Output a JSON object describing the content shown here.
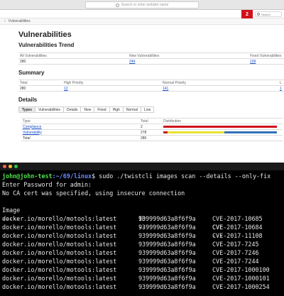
{
  "browser": {
    "url_placeholder": "Search or enter website name"
  },
  "app": {
    "alert_count": "2",
    "search_placeholder": "Search",
    "breadcrumb": "Vulnerabilities"
  },
  "report": {
    "title": "Vulnerabilities",
    "trend_title": "Vulnerabilities Trend",
    "trend_headers": [
      "All Vulnerabilities",
      "New Vulnerabilities",
      "Fixed Vulnerabilities"
    ],
    "trend_values": [
      "280",
      "244",
      "109"
    ],
    "summary_title": "Summary",
    "summary_headers": [
      "Total",
      "High Priority",
      "Normal Priority",
      "L"
    ],
    "summary_values": [
      "280",
      "12",
      "141",
      "1"
    ],
    "details_title": "Details",
    "tabs": [
      "Types",
      "Vulnerabilities",
      "Details",
      "New",
      "Fixed",
      "High",
      "Normal",
      "Low"
    ],
    "types_headers": [
      "Type",
      "Total",
      "Distribution"
    ],
    "types_rows": [
      {
        "type": "Compliance",
        "total": "2",
        "dist": {
          "high": 1.0,
          "normal": 0.0,
          "low": 0.0
        }
      },
      {
        "type": "Vulnerability",
        "total": "278",
        "dist": {
          "high": 0.04,
          "normal": 0.5,
          "low": 0.46
        }
      }
    ],
    "types_total_label": "Total",
    "types_total_value": "280"
  },
  "colors": {
    "high": "#d0111a",
    "normal": "#e8e231",
    "low": "#2f71b8"
  },
  "terminal": {
    "prompt_user": "john@john-test",
    "prompt_path": ":~/69/linux",
    "command": "$ sudo ./twistcli images scan --details --only-fix",
    "line_password": "Enter Password for admin:",
    "line_ca": "No CA cert was specified, using insecure connection",
    "headers": [
      "Image",
      "ID",
      "CVE"
    ],
    "dashes": [
      "-----",
      "--",
      "---"
    ],
    "rows": [
      [
        "docker.io/morello/motools:latest",
        "939999d63a8f6f9a",
        "CVE-2017-10685"
      ],
      [
        "docker.io/morello/motools:latest",
        "939999d63a8f6f9a",
        "CVE-2017-10684"
      ],
      [
        "docker.io/morello/motools:latest",
        "939999d63a8f6f9a",
        "CVE-2017-11108"
      ],
      [
        "docker.io/morello/motools:latest",
        "939999d63a8f6f9a",
        "CVE-2017-7245"
      ],
      [
        "docker.io/morello/motools:latest",
        "939999d63a8f6f9a",
        "CVE-2017-7246"
      ],
      [
        "docker.io/morello/motools:latest",
        "939999d63a8f6f9a",
        "CVE-2017-7244"
      ],
      [
        "docker.io/morello/motools:latest",
        "939999d63a8f6f9a",
        "CVE-2017-1000100"
      ],
      [
        "docker.io/morello/motools:latest",
        "939999d63a8f6f9a",
        "CVE-2017-1000101"
      ],
      [
        "docker.io/morello/motools:latest",
        "939999d63a8f6f9a",
        "CVE-2017-1000254"
      ]
    ]
  }
}
